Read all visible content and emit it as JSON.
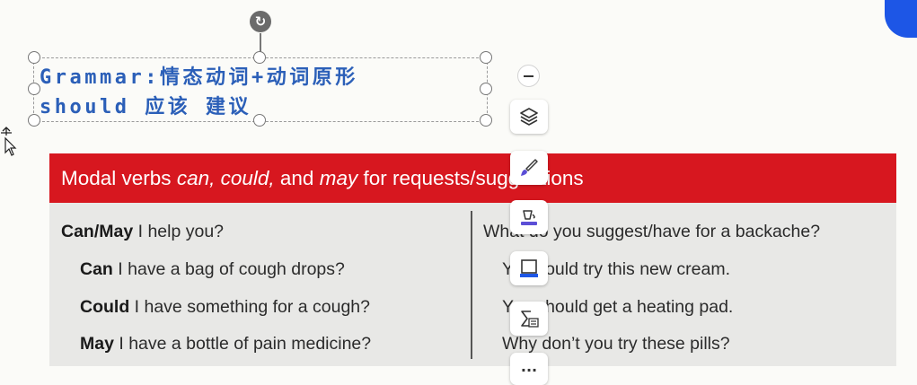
{
  "slide_text": {
    "grammar_line1": "Grammar:情态动词+动词原形",
    "grammar_line2": "should 应该 建议"
  },
  "toolbar": {
    "icons": [
      "minus-icon",
      "layers-icon",
      "brush-icon",
      "fill-icon",
      "frame-icon",
      "formula-icon",
      "more-icon"
    ],
    "more_label": "..."
  },
  "table": {
    "header_pre": "Modal verbs ",
    "header_can": "can,",
    "header_sp1": " ",
    "header_could": "could,",
    "header_mid": " and ",
    "header_may": "may",
    "header_post": " for requests/suggestions",
    "left": [
      {
        "bold": "Can/May",
        "rest": " I help you?"
      },
      {
        "bold": "Can",
        "rest": " I have a bag of cough drops?"
      },
      {
        "bold": "Could",
        "rest": " I have something for a cough?"
      },
      {
        "bold": "May",
        "rest": " I have a bottle of pain medicine?"
      }
    ],
    "right": [
      "What do you suggest/have for a backache?",
      "You could try this new cream.",
      "You should get a heating pad.",
      "Why don’t you try these pills?"
    ]
  },
  "colors": {
    "header_red": "#d7171f",
    "text_blue": "#2b5fb8",
    "accent_blue": "#1d56e6"
  }
}
